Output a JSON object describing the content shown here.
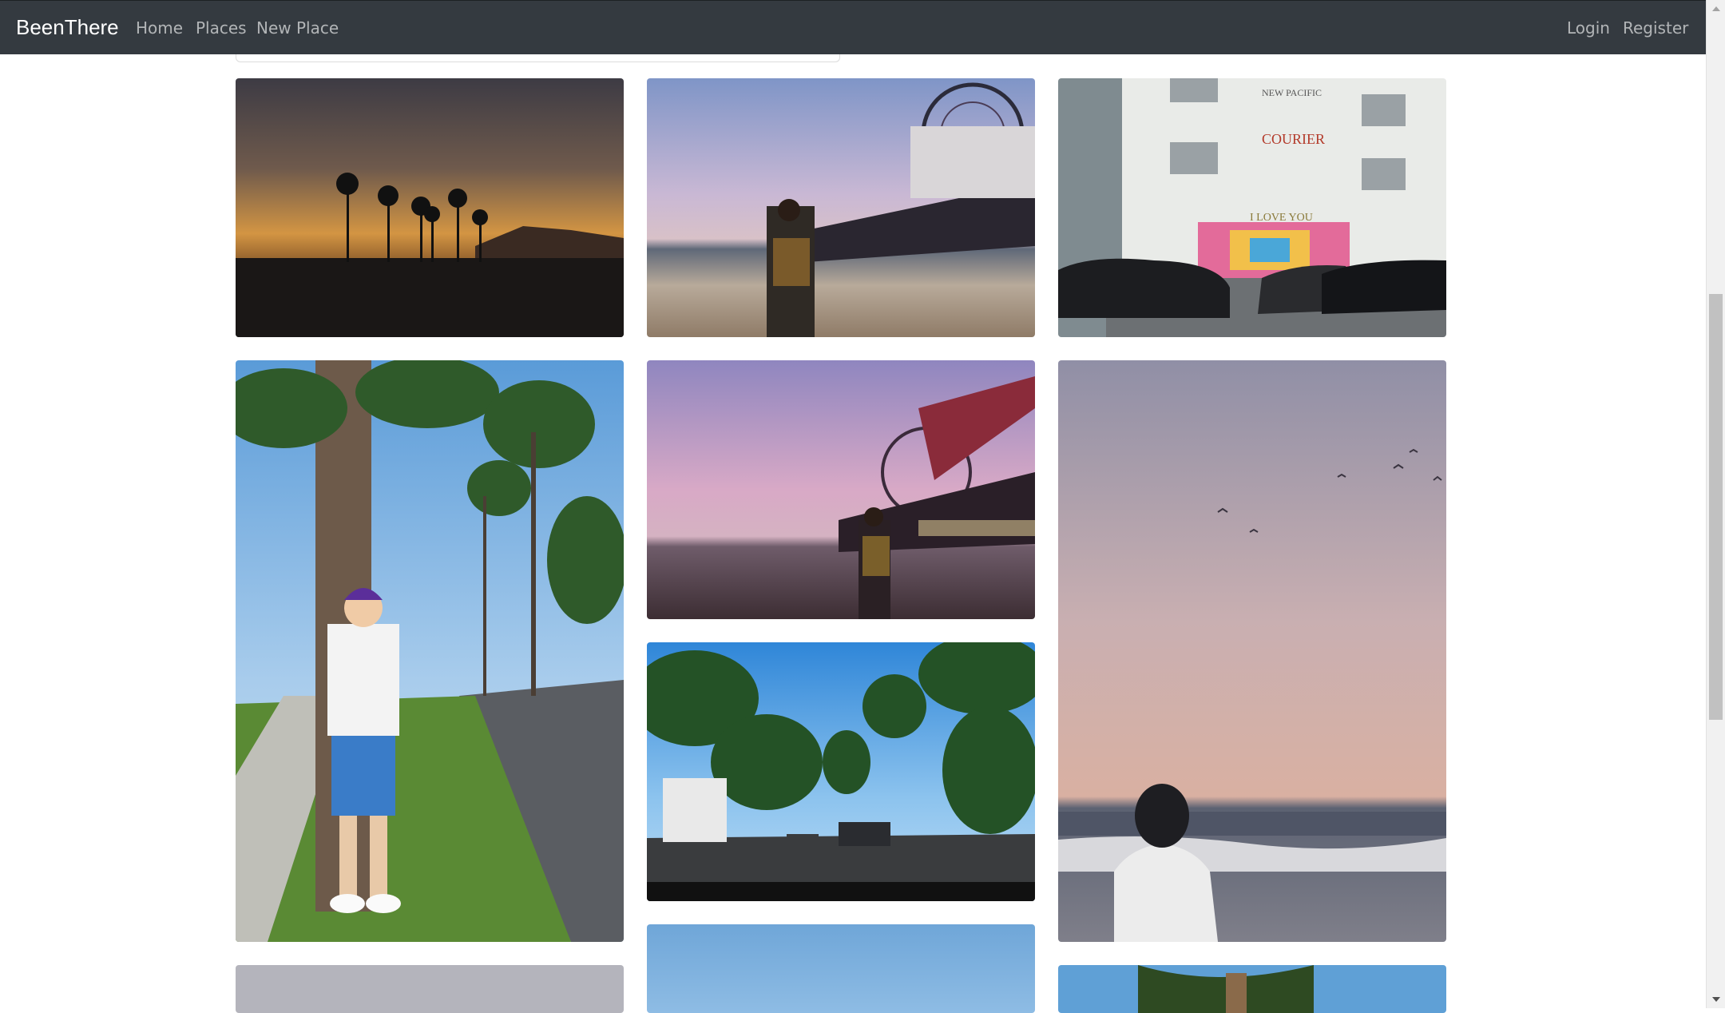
{
  "navbar": {
    "brand": "BeenThere",
    "left_links": [
      "Home",
      "Places",
      "New Place"
    ],
    "right_links": [
      "Login",
      "Register"
    ]
  },
  "gallery": {
    "photos": [
      {
        "subject": "palm silhouettes at sunset"
      },
      {
        "subject": "woman on beach by pier ferris wheel"
      },
      {
        "subject": "building with I LOVE YOU mural",
        "sign_text": [
          "NEW PACIFIC",
          "COURIER",
          "I LOVE YOU"
        ]
      },
      {
        "subject": "man standing by palm tree on sidewalk"
      },
      {
        "subject": "man on beach at dusk under ferris wheel"
      },
      {
        "subject": "person watching ocean at sunset"
      },
      {
        "subject": "palm lined street"
      },
      {
        "subject": "partial photo sky"
      },
      {
        "subject": "partial photo blue sky"
      },
      {
        "subject": "partial photo palm crown"
      }
    ]
  },
  "colors": {
    "navbar_bg": "#343a40",
    "nav_link": "rgba(255,255,255,0.62)",
    "brand": "#ffffff"
  }
}
